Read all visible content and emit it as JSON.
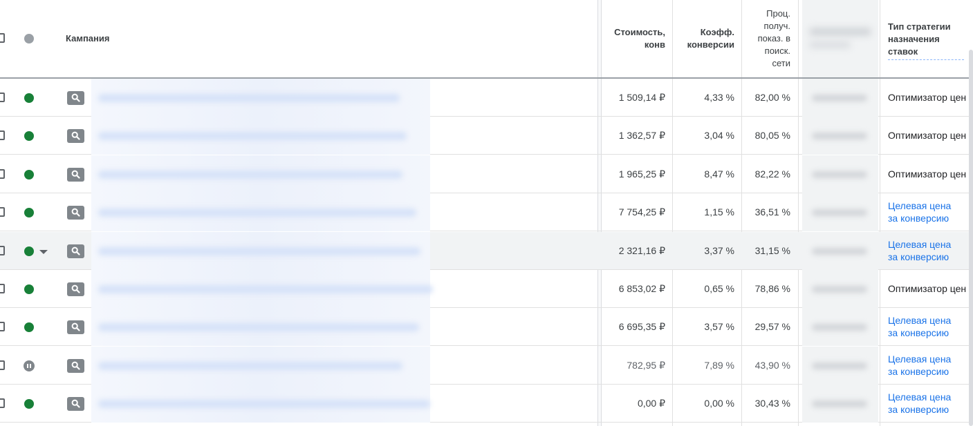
{
  "header": {
    "campaign": "Кампания",
    "cost_per_conv": [
      "Стоимость,",
      "конв"
    ],
    "conv_rate": [
      "Коэфф.",
      "конверсии"
    ],
    "search_impr_share": [
      "Проц.",
      "получ.",
      "показ. в",
      "поиск.",
      "сети"
    ],
    "bid_strategy_type": [
      "Тип стратегии",
      "назначения",
      "ставок"
    ]
  },
  "rows": [
    {
      "status": "enabled",
      "cost": "1 509,14 ₽",
      "rate": "4,33 %",
      "share": "82,00 %",
      "strategy": [
        "Оптимизатор цен"
      ],
      "strategy_link": false
    },
    {
      "status": "enabled",
      "cost": "1 362,57 ₽",
      "rate": "3,04 %",
      "share": "80,05 %",
      "strategy": [
        "Оптимизатор цен"
      ],
      "strategy_link": false
    },
    {
      "status": "enabled",
      "cost": "1 965,25 ₽",
      "rate": "8,47 %",
      "share": "82,22 %",
      "strategy": [
        "Оптимизатор цен"
      ],
      "strategy_link": false
    },
    {
      "status": "enabled",
      "cost": "7 754,25 ₽",
      "rate": "1,15 %",
      "share": "36,51 %",
      "strategy": [
        "Целевая цена",
        "за конверсию"
      ],
      "strategy_link": true
    },
    {
      "status": "enabled",
      "cost": "2 321,16 ₽",
      "rate": "3,37 %",
      "share": "31,15 %",
      "strategy": [
        "Целевая цена",
        "за конверсию"
      ],
      "strategy_link": true
    },
    {
      "status": "enabled",
      "cost": "6 853,02 ₽",
      "rate": "0,65 %",
      "share": "78,86 %",
      "strategy": [
        "Оптимизатор цен"
      ],
      "strategy_link": false
    },
    {
      "status": "enabled",
      "cost": "6 695,35 ₽",
      "rate": "3,57 %",
      "share": "29,57 %",
      "strategy": [
        "Целевая цена",
        "за конверсию"
      ],
      "strategy_link": true
    },
    {
      "status": "paused",
      "cost": "782,95 ₽",
      "rate": "7,89 %",
      "share": "43,90 %",
      "strategy": [
        "Целевая цена",
        "за конверсию"
      ],
      "strategy_link": true
    },
    {
      "status": "enabled",
      "cost": "0,00 ₽",
      "rate": "0,00 %",
      "share": "30,43 %",
      "strategy": [
        "Целевая цена",
        "за конверсию"
      ],
      "strategy_link": true
    }
  ],
  "colors": {
    "enabled": "#188038",
    "paused": "#80868b",
    "link": "#1a73e8"
  },
  "icons": {
    "campaign_type": "search-icon",
    "status_header": "status-dot-icon",
    "row_menu": "dropdown-arrow-icon"
  }
}
